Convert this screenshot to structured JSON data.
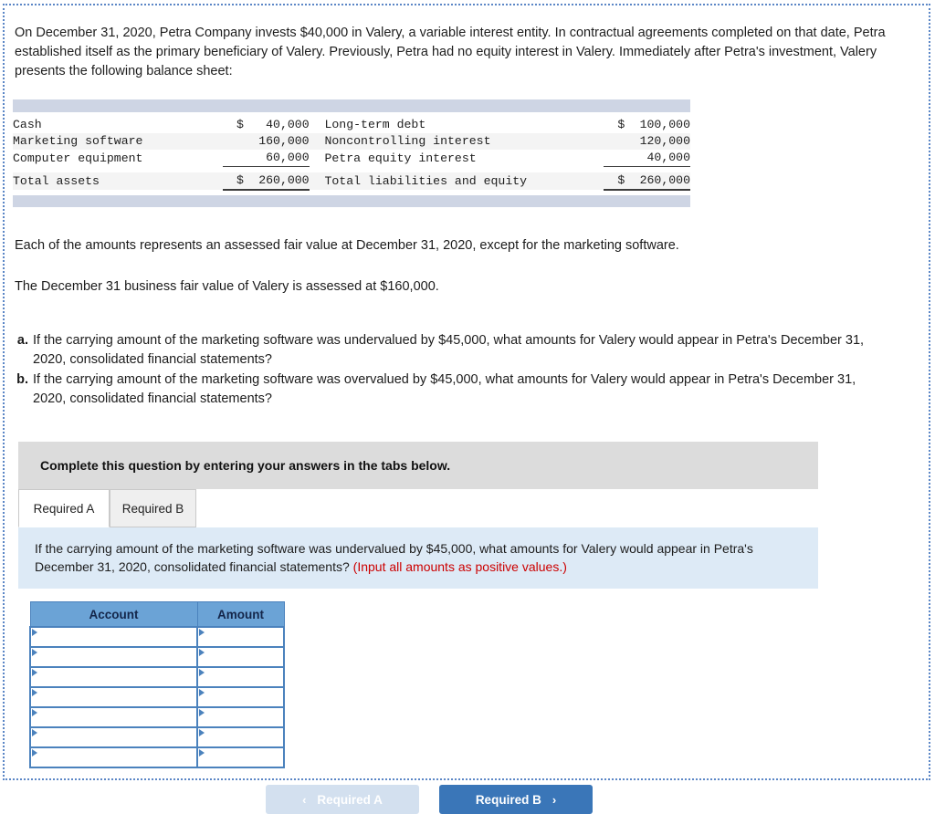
{
  "intro": {
    "paragraph": "On December 31, 2020, Petra Company invests $40,000 in Valery, a variable interest entity. In contractual agreements completed on that date, Petra established itself as the primary beneficiary of Valery. Previously, Petra had no equity interest in Valery. Immediately after Petra's investment, Valery presents the following balance sheet:"
  },
  "balance_sheet": {
    "rows": [
      {
        "asset_label": "Cash",
        "asset_currency": "$",
        "asset_amount": "40,000",
        "liab_label": "Long-term debt",
        "liab_currency": "$",
        "liab_amount": "100,000"
      },
      {
        "asset_label": "Marketing software",
        "asset_currency": "",
        "asset_amount": "160,000",
        "liab_label": "Noncontrolling interest",
        "liab_currency": "",
        "liab_amount": "120,000"
      },
      {
        "asset_label": "Computer equipment",
        "asset_currency": "",
        "asset_amount": "60,000",
        "liab_label": "Petra equity interest",
        "liab_currency": "",
        "liab_amount": "40,000"
      }
    ],
    "total": {
      "asset_label": "Total assets",
      "asset_currency": "$",
      "asset_amount": "260,000",
      "liab_label": "Total liabilities and equity",
      "liab_currency": "$",
      "liab_amount": "260,000"
    }
  },
  "statements": {
    "line1": "Each of the amounts represents an assessed fair value at December 31, 2020, except for the marketing software.",
    "line2": "The December 31 business fair value of Valery is assessed at $160,000."
  },
  "requirements": [
    {
      "letter": "a.",
      "text": "If the carrying amount of the marketing software was undervalued by $45,000, what amounts for Valery would appear in Petra's December 31, 2020, consolidated financial statements?"
    },
    {
      "letter": "b.",
      "text": "If the carrying amount of the marketing software was overvalued by $45,000, what amounts for Valery would appear in Petra's December 31, 2020, consolidated financial statements?"
    }
  ],
  "banner": {
    "text": "Complete this question by entering your answers in the tabs below."
  },
  "tabs": [
    {
      "label": "Required A",
      "active": true
    },
    {
      "label": "Required B",
      "active": false
    }
  ],
  "instruction": {
    "main": "If the carrying amount of the marketing software was undervalued by $45,000, what amounts for Valery would appear in Petra's December 31, 2020, consolidated financial statements?",
    "hint": "(Input all amounts as positive values.)",
    "hint_color": "#cc0000"
  },
  "answer_table": {
    "headers": [
      "Account",
      "Amount"
    ],
    "rows": [
      [
        "",
        ""
      ],
      [
        "",
        ""
      ],
      [
        "",
        ""
      ],
      [
        "",
        ""
      ],
      [
        "",
        ""
      ],
      [
        "",
        ""
      ],
      [
        "",
        ""
      ]
    ]
  },
  "nav": {
    "prev_label": "Required A",
    "prev_chevron": "‹",
    "next_label": "Required B",
    "next_chevron": "›",
    "prev_color": "#d3e0ef",
    "next_color": "#3a76b8"
  }
}
